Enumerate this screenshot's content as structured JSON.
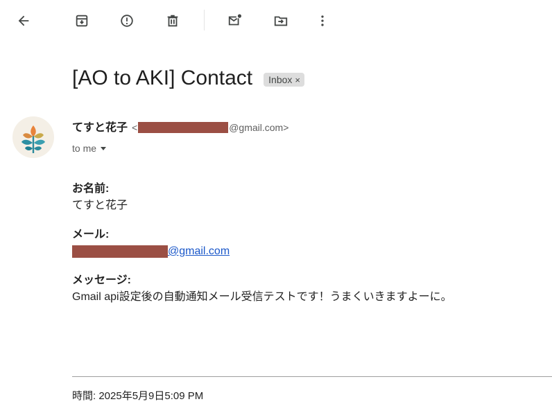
{
  "toolbar": {
    "buttons": [
      {
        "name": "back",
        "icon": "arrow-left-icon"
      },
      {
        "name": "archive",
        "icon": "archive-icon"
      },
      {
        "name": "report-spam",
        "icon": "report-spam-icon"
      },
      {
        "name": "delete",
        "icon": "trash-icon"
      },
      {
        "name": "mark-unread",
        "icon": "mark-unread-icon"
      },
      {
        "name": "move-to",
        "icon": "move-to-folder-icon"
      },
      {
        "name": "more",
        "icon": "more-vertical-icon"
      }
    ]
  },
  "email": {
    "subject": "[AO to AKI] Contact",
    "label": "Inbox",
    "label_close": "×",
    "sender": {
      "name": "てすと花子",
      "addr_open": "<",
      "addr_domain": "@gmail.com>",
      "to_text": "to me"
    },
    "body": {
      "name_label": "お名前:",
      "name_value": "てすと花子",
      "mail_label": "メール:",
      "mail_value_domain": "@gmail.com",
      "message_label": "メッセージ:",
      "message_value": "Gmail api設定後の自動通知メール受信テストです！うまくいきますよーに。"
    },
    "timestamp": "時間: 2025年5月9日5:09 PM"
  },
  "colors": {
    "redaction": "#9b4f44",
    "link": "#1a57c9",
    "chip_bg": "#dddddd",
    "avatar_bg": "#f4efe6"
  }
}
